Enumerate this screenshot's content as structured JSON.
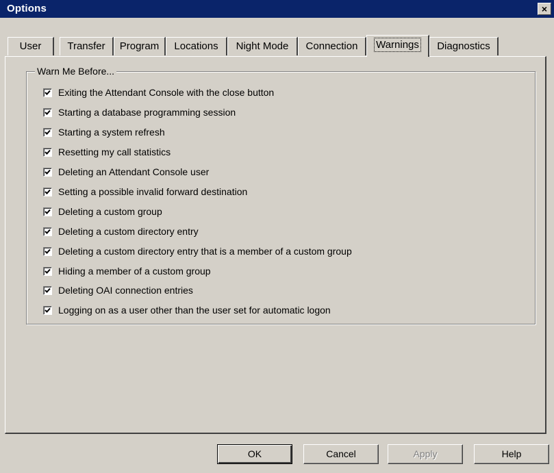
{
  "window": {
    "title": "Options",
    "close_label": "×"
  },
  "tabs": [
    {
      "label": "User"
    },
    {
      "label": "Transfer"
    },
    {
      "label": "Program"
    },
    {
      "label": "Locations"
    },
    {
      "label": "Night Mode"
    },
    {
      "label": "Connection"
    },
    {
      "label": "Warnings"
    },
    {
      "label": "Diagnostics"
    }
  ],
  "active_tab": "Warnings",
  "group": {
    "legend": "Warn Me Before..."
  },
  "options": [
    {
      "label": "Exiting the Attendant Console with the close button",
      "checked": true
    },
    {
      "label": "Starting a database programming session",
      "checked": true
    },
    {
      "label": "Starting a system refresh",
      "checked": true
    },
    {
      "label": "Resetting my call statistics",
      "checked": true
    },
    {
      "label": "Deleting an Attendant Console user",
      "checked": true
    },
    {
      "label": "Setting a possible invalid forward destination",
      "checked": true
    },
    {
      "label": "Deleting a custom group",
      "checked": true
    },
    {
      "label": "Deleting a custom directory entry",
      "checked": true
    },
    {
      "label": "Deleting a custom directory entry that is a member of a custom group",
      "checked": true
    },
    {
      "label": "Hiding a member of a custom group",
      "checked": true
    },
    {
      "label": "Deleting OAI connection entries",
      "checked": true
    },
    {
      "label": "Logging on as a user other than the user set for automatic logon",
      "checked": true
    }
  ],
  "buttons": {
    "ok": "OK",
    "cancel": "Cancel",
    "apply": "Apply",
    "help": "Help"
  },
  "colors": {
    "titlebar": "#0a246a",
    "face": "#d4d0c8"
  }
}
